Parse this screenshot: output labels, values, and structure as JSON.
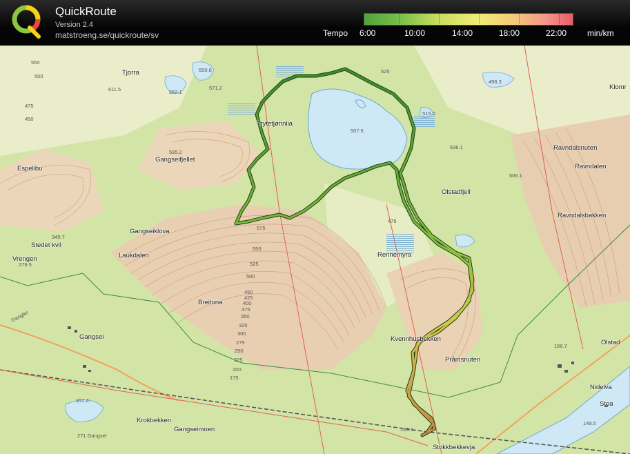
{
  "header": {
    "app_title": "QuickRoute",
    "version": "Version 2.4",
    "url": "matstroeng.se/quickroute/sv",
    "pace_label": "Tempo",
    "pace_ticks": [
      "6:00",
      "10:00",
      "14:00",
      "18:00",
      "22:00"
    ],
    "pace_unit": "min/km",
    "pace_gradient_colors": [
      "#4fa23c",
      "#7cc14b",
      "#c9dc5e",
      "#f0ec77",
      "#f6c879",
      "#f29389",
      "#e85c67"
    ]
  },
  "map": {
    "colors": {
      "open_land": "#d3e4a7",
      "forest": "#eef0cd",
      "terrain_brown": "#e8cdb0",
      "water": "#cfe8f5",
      "contour": "#c9936b",
      "route_fast": "#2e8b2e",
      "route_slow": "#d99a3a",
      "boundary_red": "#e06050",
      "boundary_green": "#3d8a3d"
    },
    "place_names": [
      "Tjorra",
      "Trytetjønnlia",
      "Gangseifjellet",
      "Espelibu",
      "Gangseiklova",
      "Stedet kvil",
      "Vrengen",
      "Laukdalen",
      "Breitona",
      "Gangsei",
      "Krokbekken",
      "Gangseimoen",
      "Olstadfjell",
      "Rennemyra",
      "Ravndalsnuten",
      "Ravndalen",
      "Ravndalsbakken",
      "Kvennhusbekken",
      "Pråmsnuten",
      "Olstad",
      "Nidelva",
      "Stoa",
      "Stokkbekkevja",
      "Klomr"
    ],
    "elevations": [
      "525",
      "550",
      "500",
      "475",
      "450",
      "611.5",
      "550.8",
      "571.2",
      "552.1",
      "507.6",
      "515.0",
      "496.3",
      "536.1",
      "595.2",
      "506.1",
      "575",
      "550",
      "525",
      "500",
      "475",
      "450",
      "425",
      "400",
      "375",
      "350",
      "325",
      "300",
      "275",
      "250",
      "225",
      "200",
      "175",
      "349.7",
      "279.5",
      "166.7",
      "149.5",
      "149.3",
      "151.4",
      "271 Gangsei",
      "Gangfer"
    ]
  }
}
